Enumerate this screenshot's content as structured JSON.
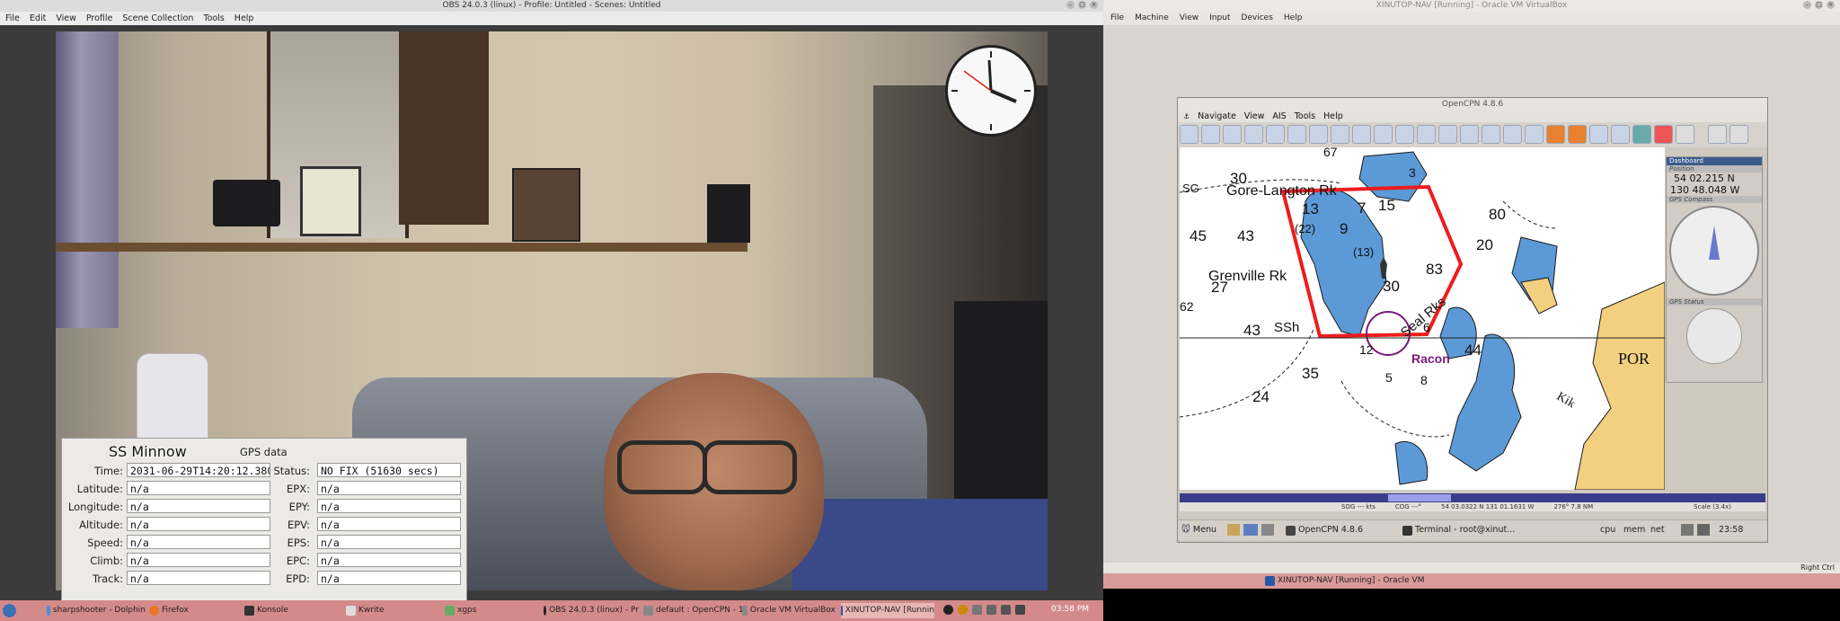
{
  "obs": {
    "title": "OBS 24.0.3 (linux) - Profile: Untitled - Scenes: Untitled",
    "menu": [
      "File",
      "Edit",
      "View",
      "Profile",
      "Scene Collection",
      "Tools",
      "Help"
    ]
  },
  "gps_panel": {
    "name": "SS Minnow",
    "heading": "GPS data",
    "left_rows": [
      {
        "label": "Time:",
        "value": "2031-06-29T14:20:12.380"
      },
      {
        "label": "Latitude:",
        "value": "n/a"
      },
      {
        "label": "Longitude:",
        "value": "n/a"
      },
      {
        "label": "Altitude:",
        "value": "n/a"
      },
      {
        "label": "Speed:",
        "value": "n/a"
      },
      {
        "label": "Climb:",
        "value": "n/a"
      },
      {
        "label": "Track:",
        "value": "n/a"
      }
    ],
    "right_rows": [
      {
        "label": "Status:",
        "value": "NO FIX (51630 secs)"
      },
      {
        "label": "EPX:",
        "value": "n/a"
      },
      {
        "label": "EPY:",
        "value": "n/a"
      },
      {
        "label": "EPV:",
        "value": "n/a"
      },
      {
        "label": "EPS:",
        "value": "n/a"
      },
      {
        "label": "EPC:",
        "value": "n/a"
      },
      {
        "label": "EPD:",
        "value": "n/a"
      }
    ]
  },
  "taskbar": {
    "items": [
      "sharpshooter - Dolphin",
      "Firefox",
      "Konsole",
      "Kwrite",
      "xgps",
      "OBS 24.0.3 (linux) - Pr",
      "default : OpenCPN - 1",
      "Oracle VM VirtualBox",
      "XINUTOP-NAV [Runnin"
    ],
    "clock": "03:58 PM"
  },
  "vbox": {
    "title": "XINUTOP-NAV [Running] - Oracle VM VirtualBox",
    "menu": [
      "File",
      "Machine",
      "View",
      "Input",
      "Devices",
      "Help"
    ],
    "bottom_task": "XINUTOP-NAV [Running] - Oracle VM",
    "host_key": "Right Ctrl"
  },
  "opencpn": {
    "title": "OpenCPN 4.8.6",
    "menu": [
      "Navigate",
      "View",
      "AIS",
      "Tools",
      "Help"
    ],
    "dashboard": {
      "title": "Dashboard",
      "position_label": "Position",
      "lat": "54 02.215 N",
      "lon": "130 48.048 W",
      "compass_label": "GPS Compass",
      "status_label": "GPS Status"
    },
    "info": {
      "sog": "SOG --- kts",
      "cog": "COG ---°",
      "pos": "54 03.0322 N  131 01.1631 W",
      "brg": "276°  7.8 NM",
      "scale": "Scale (3.4x)"
    },
    "chart_labels": {
      "gore": "Gore-Langton Rk",
      "grenville": "Grenville Rk",
      "seal": "Seal Rks",
      "racon": "Racon",
      "por": "POR",
      "kik": "Kik",
      "ssh": "SSh",
      "sg": "SG",
      "depths": [
        "30",
        "43",
        "45",
        "27",
        "43",
        "35",
        "24",
        "83",
        "30",
        "80",
        "20",
        "44",
        "13",
        "15",
        "(22)",
        "(13)",
        "9",
        "7",
        "6",
        "5",
        "8",
        "3",
        "12",
        "67",
        "62"
      ]
    },
    "taskbar": {
      "menu": "Menu",
      "items": [
        "OpenCPN 4.8.6",
        "Terminal - root@xinut..."
      ],
      "indicators": [
        "cpu",
        "mem",
        "net"
      ],
      "clock": "23:58"
    }
  }
}
